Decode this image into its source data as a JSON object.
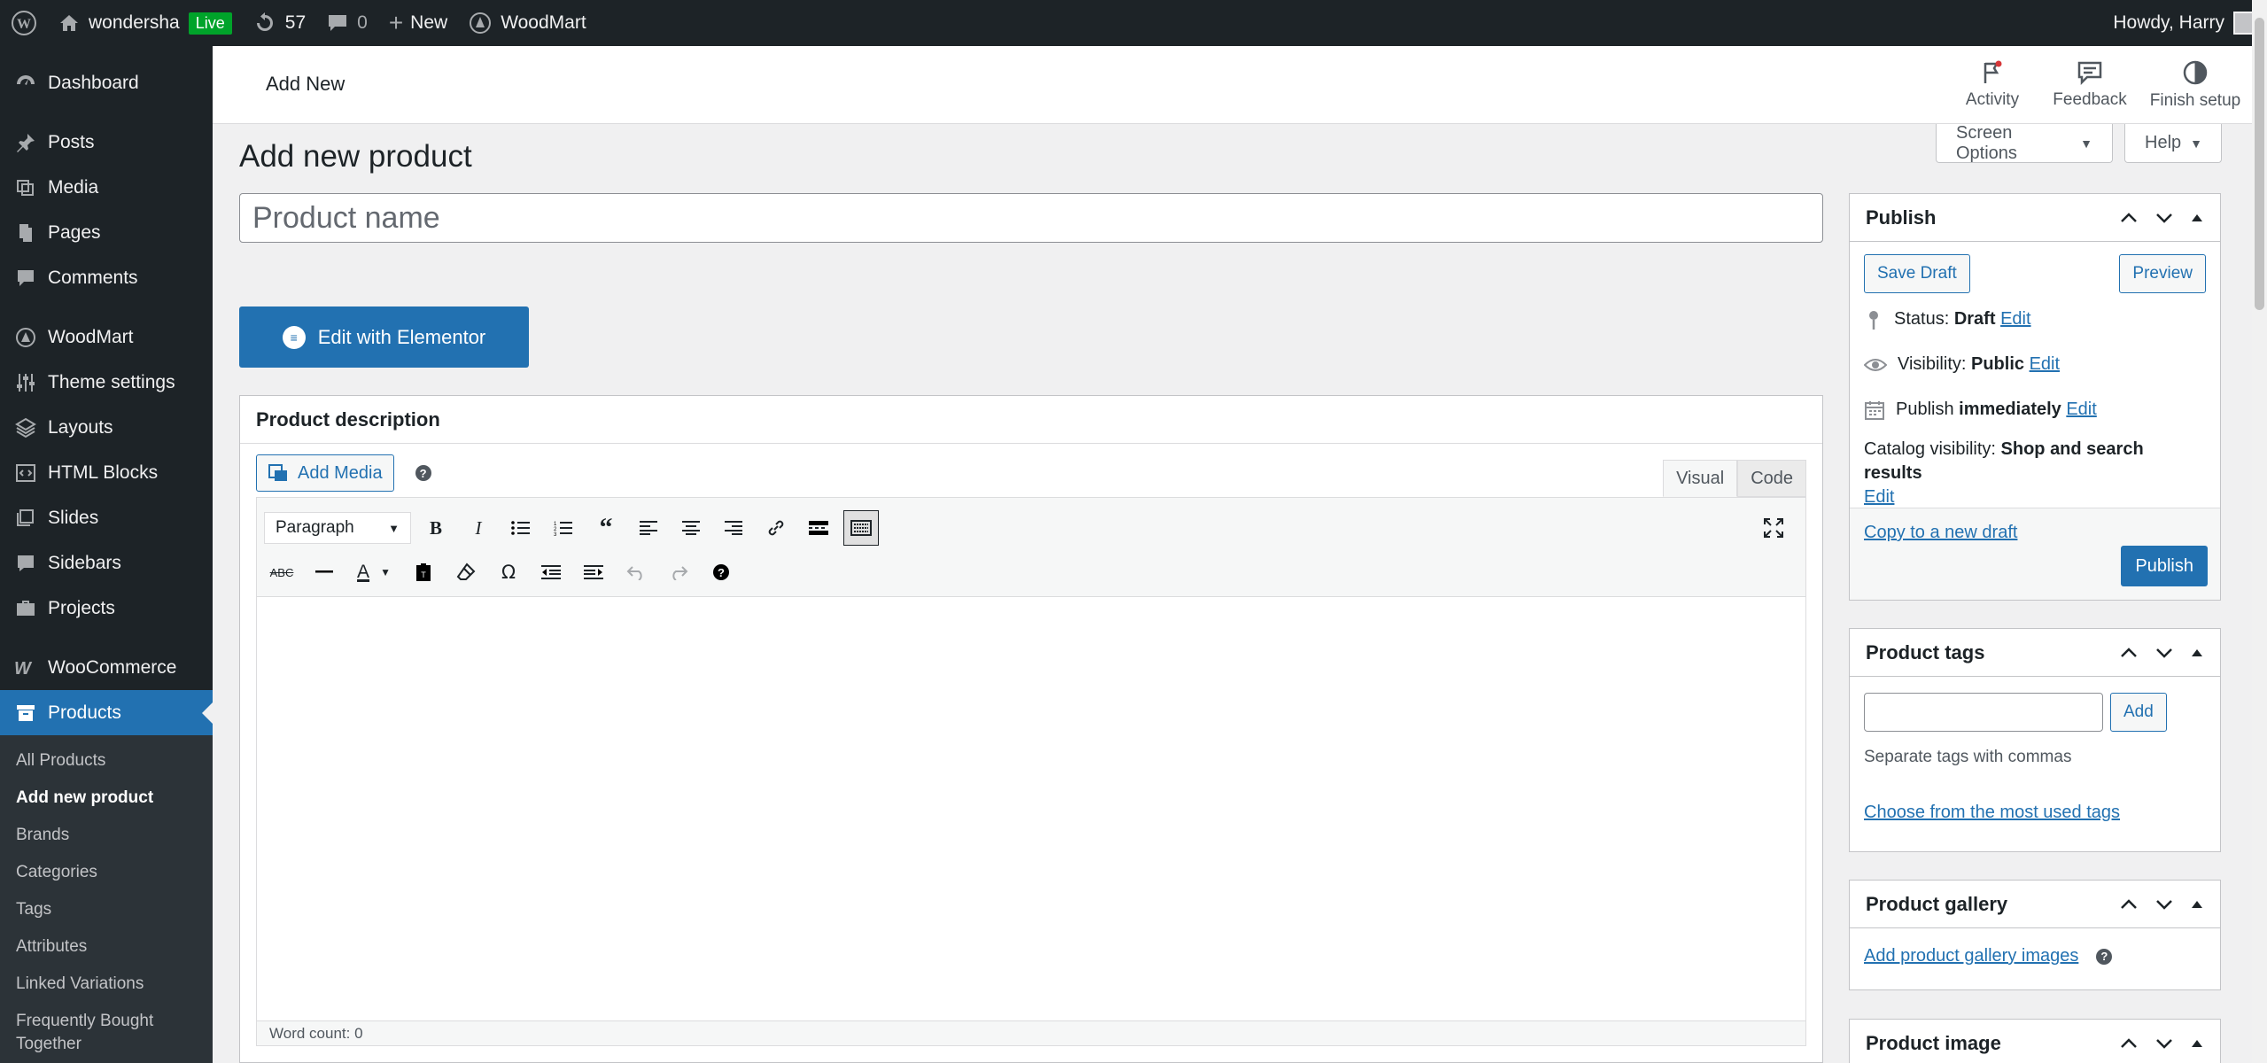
{
  "adminbar": {
    "site_name": "wondersha",
    "live_badge": "Live",
    "updates_count": "57",
    "comments_count": "0",
    "new_label": "New",
    "theme_label": "WoodMart",
    "howdy": "Howdy, Harry"
  },
  "sidebar": {
    "dashboard": "Dashboard",
    "posts": "Posts",
    "media": "Media",
    "pages": "Pages",
    "comments": "Comments",
    "woodmart": "WoodMart",
    "theme_settings": "Theme settings",
    "layouts": "Layouts",
    "html_blocks": "HTML Blocks",
    "slides": "Slides",
    "sidebars": "Sidebars",
    "projects": "Projects",
    "woocommerce": "WooCommerce",
    "products": "Products",
    "submenu": {
      "all_products": "All Products",
      "add_new_product": "Add new product",
      "brands": "Brands",
      "categories": "Categories",
      "tags": "Tags",
      "attributes": "Attributes",
      "linked_variations": "Linked Variations",
      "frequently_bought": "Frequently Bought Together"
    }
  },
  "header": {
    "breadcrumb": "Add New",
    "activity": "Activity",
    "feedback": "Feedback",
    "finish_setup": "Finish setup"
  },
  "screen_options": "Screen Options",
  "help": "Help",
  "page_title": "Add new product",
  "product_name_placeholder": "Product name",
  "elementor_button": "Edit with Elementor",
  "description": {
    "title": "Product description",
    "add_media": "Add Media",
    "help_mark": "?",
    "tab_visual": "Visual",
    "tab_code": "Code",
    "format_select": "Paragraph",
    "word_count": "Word count: 0"
  },
  "publish": {
    "title": "Publish",
    "save_draft": "Save Draft",
    "preview": "Preview",
    "status_label": "Status:",
    "status_value": "Draft",
    "visibility_label": "Visibility:",
    "visibility_value": "Public",
    "publish_label": "Publish",
    "publish_value": "immediately",
    "catalog_label": "Catalog visibility:",
    "catalog_value": "Shop and search results",
    "edit": "Edit",
    "copy_draft": "Copy to a new draft",
    "publish_button": "Publish"
  },
  "tags": {
    "title": "Product tags",
    "add_button": "Add",
    "hint": "Separate tags with commas",
    "choose_link": "Choose from the most used tags"
  },
  "gallery": {
    "title": "Product gallery",
    "add_link": "Add product gallery images"
  },
  "product_image": {
    "title": "Product image"
  },
  "colors": {
    "accent": "#2271b1",
    "admin_dark": "#1d2327",
    "live_green": "#00a32a"
  }
}
